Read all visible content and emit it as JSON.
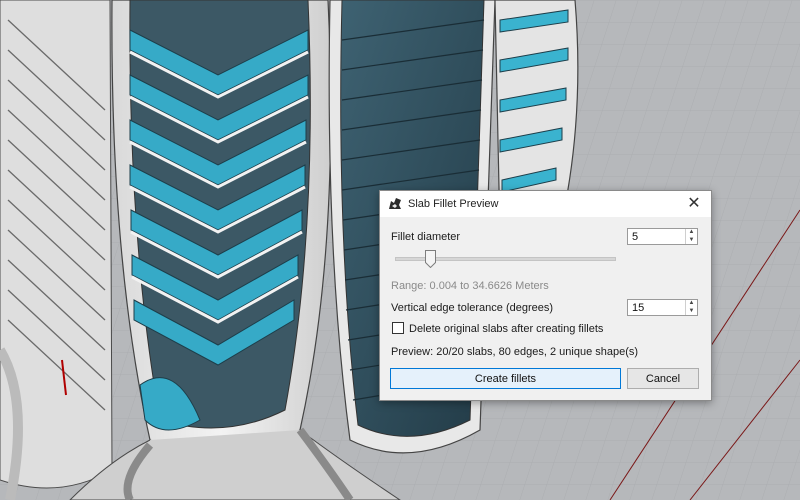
{
  "dialog": {
    "title": "Slab Fillet Preview",
    "close_glyph": "✕",
    "fillet_diameter": {
      "label": "Fillet diameter",
      "value": "5",
      "slider_fraction": 0.144
    },
    "range_text": "Range: 0.004 to 34.6626 Meters",
    "vertical_tolerance": {
      "label": "Vertical edge tolerance (degrees)",
      "value": "15"
    },
    "delete_original": {
      "label": "Delete original slabs after creating fillets",
      "checked": false
    },
    "preview_text": "Preview: 20/20 slabs, 80 edges, 2 unique shape(s)",
    "create_button": "Create fillets",
    "cancel_button": "Cancel"
  },
  "colors": {
    "accent_blue": "#0078d7",
    "slab_cyan": "#3ab3cf",
    "facade_white": "#eeeeee",
    "glass_dark": "#2d4c5c",
    "grid_background": "#b8babd"
  },
  "icons": [
    "rhino-app-icon",
    "close-icon",
    "spin-up-icon",
    "spin-down-icon",
    "slider-thumb-icon",
    "mouse-cursor-icon"
  ]
}
